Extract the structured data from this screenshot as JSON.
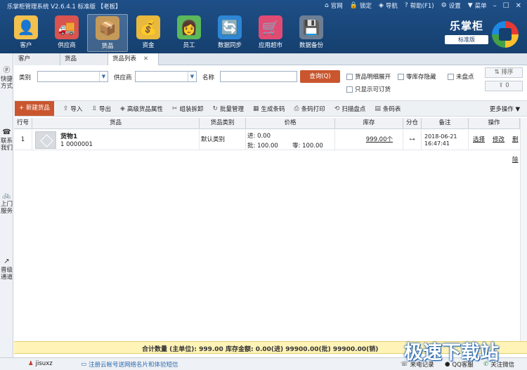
{
  "titlebar": {
    "app_title": "乐掌柜管理系统 V2.6.4.1 标准版 【老板】",
    "menu": [
      {
        "icon": "home-icon",
        "glyph": "⌂",
        "label": "官网"
      },
      {
        "icon": "lock-icon",
        "glyph": "🔒",
        "label": "锁定"
      },
      {
        "icon": "compass-icon",
        "glyph": "◈",
        "label": "导航"
      },
      {
        "icon": "help-icon",
        "glyph": "?",
        "label": "帮助(F1)"
      },
      {
        "icon": "gear-icon",
        "glyph": "⚙",
        "label": "设置"
      },
      {
        "icon": "shirt-icon",
        "glyph": "▼",
        "label": "菜单"
      }
    ],
    "controls": {
      "minimize": "–",
      "maximize": "☐",
      "close": "✕"
    }
  },
  "nav": [
    {
      "label": "客户",
      "icon": "customer-icon",
      "glyph": "👤",
      "color": "#f2c14e",
      "active": false
    },
    {
      "label": "供应商",
      "icon": "supplier-icon",
      "glyph": "🚚",
      "color": "#d9534f",
      "active": false
    },
    {
      "label": "货品",
      "icon": "goods-icon",
      "glyph": "📦",
      "color": "#c49a5a",
      "active": true
    },
    {
      "label": "资金",
      "icon": "money-icon",
      "glyph": "💰",
      "color": "#e8b93c",
      "active": false
    },
    {
      "label": "员工",
      "icon": "employee-icon",
      "glyph": "👩",
      "color": "#5bb85b",
      "active": false
    },
    {
      "label": "数据同步",
      "icon": "sync-icon",
      "glyph": "🔄",
      "color": "#2e86d4",
      "active": false
    },
    {
      "label": "应用超市",
      "icon": "market-icon",
      "glyph": "🛒",
      "color": "#e04b74",
      "active": false
    },
    {
      "label": "数据备份",
      "icon": "backup-icon",
      "glyph": "💾",
      "color": "#6d7f95",
      "active": false
    }
  ],
  "brand": {
    "name": "乐掌柜",
    "edition": "标准版"
  },
  "leftbar": [
    {
      "glyph": "ⓟ",
      "label": "快捷方式",
      "icon": "shortcut-icon"
    },
    {
      "glyph": "☎",
      "label": "联系我们",
      "icon": "phone-icon"
    },
    {
      "glyph": "🚲",
      "label": "上门服务",
      "icon": "bike-icon"
    },
    {
      "glyph": "↗",
      "label": "晋级通道",
      "icon": "upgrade-icon"
    }
  ],
  "tabs": [
    {
      "label": "客户",
      "active": false,
      "closable": false
    },
    {
      "label": "货品",
      "active": false,
      "closable": false
    },
    {
      "label": "货品列表",
      "active": true,
      "closable": true,
      "close": "✕"
    }
  ],
  "filters": {
    "category_label": "类别",
    "supplier_label": "供应商",
    "name_label": "名称",
    "query_label": "查询(Q)",
    "checkboxes": {
      "expand_detail": "货品明细展开",
      "hide_zero": "零库存隐藏",
      "not_counted": "未盘点",
      "orderable_only": "只显示可订货"
    },
    "sort_label": "排序",
    "count_value": "0"
  },
  "actions": {
    "new": "+ 新建货品",
    "items": [
      {
        "glyph": "⇪",
        "label": "导入",
        "icon": "import-icon"
      },
      {
        "glyph": "⇫",
        "label": "导出",
        "icon": "export-icon"
      },
      {
        "glyph": "◈",
        "label": "高级货品属性",
        "icon": "tag-icon"
      },
      {
        "glyph": "✂",
        "label": "组装拆卸",
        "icon": "scissors-icon"
      },
      {
        "glyph": "↻",
        "label": "批量管理",
        "icon": "refresh-icon"
      },
      {
        "glyph": "▦",
        "label": "生成条码",
        "icon": "barcode-icon"
      },
      {
        "glyph": "⎙",
        "label": "条码打印",
        "icon": "print-icon"
      },
      {
        "glyph": "⟲",
        "label": "扫描盘点",
        "icon": "scan-icon"
      },
      {
        "glyph": "▤",
        "label": "条码表",
        "icon": "barcode-table-icon"
      }
    ],
    "more": "更多操作 ▼"
  },
  "table": {
    "headers": [
      "行号",
      "货品",
      "货品类别",
      "价格",
      "库存",
      "分仓",
      "备注",
      "操作"
    ],
    "rows": [
      {
        "index": "1",
        "name": "货物1",
        "code": "1 0000001",
        "category": "默认类别",
        "price_in": "进: 0.00",
        "price_wholesale": "批: 100.00",
        "price_retail": "零: 100.00",
        "stock": "999.00个",
        "remark_date": "2018-06-21",
        "remark_time": "16:47:41",
        "ops": [
          "选择",
          "修改",
          "删除"
        ]
      }
    ]
  },
  "summary": "合计数量 (主单位): 999.00 库存金额: 0.00(进) 99900.00(批) 99900.00(销)",
  "status": {
    "user": "jisuxz",
    "register_link": "注册云帐号送网络名片和体验短信",
    "call_record": "来电记录",
    "qq_service": "QQ客服",
    "wechat": "关注微信"
  },
  "watermark": "极速下载站"
}
